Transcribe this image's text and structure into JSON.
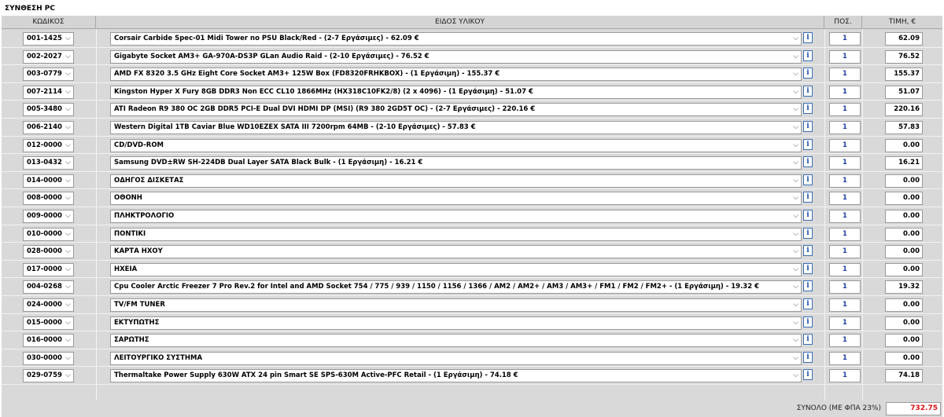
{
  "title": "ΣΥΝΘΕΣΗ PC",
  "headers": {
    "code": "ΚΩΔΙΚΟΣ",
    "item": "ΕΙΔΟΣ ΥΛΙΚΟΥ",
    "qty": "ΠΟΣ.",
    "price": "ΤΙΜΗ, €"
  },
  "info_glyph": "i",
  "chevron_glyph": "⌵",
  "rows": [
    {
      "code": "001-1425",
      "item": "Corsair Carbide Spec-01 Midi Tower no PSU Black/Red - (2-7 Εργάσιμες) - 62.09 €",
      "qty": "1",
      "price": "62.09"
    },
    {
      "code": "002-2027",
      "item": "Gigabyte Socket AM3+ GA-970A-DS3P GLan Audio Raid - (2-10 Εργάσιμες) - 76.52 €",
      "qty": "1",
      "price": "76.52"
    },
    {
      "code": "003-0779",
      "item": "AMD FX 8320 3.5 GHz Eight Core Socket AM3+ 125W Box (FD8320FRHKBOX) - (1 Εργάσιμη) - 155.37 €",
      "qty": "1",
      "price": "155.37"
    },
    {
      "code": "007-2114",
      "item": "Kingston Hyper X Fury 8GB DDR3 Non ECC CL10 1866MHz (HX318C10FK2/8) (2 x 4096) - (1 Εργάσιμη) - 51.07 €",
      "qty": "1",
      "price": "51.07"
    },
    {
      "code": "005-3480",
      "item": "ATI Radeon R9 380 OC 2GB DDR5 PCI-E Dual DVI HDMI DP (MSI) (R9 380 2GD5T OC) - (2-7 Εργάσιμες) - 220.16 €",
      "qty": "1",
      "price": "220.16"
    },
    {
      "code": "006-2140",
      "item": "Western Digital 1TB Caviar Blue WD10EZEX SATA III 7200rpm 64MB - (2-10 Εργάσιμες) - 57.83 €",
      "qty": "1",
      "price": "57.83"
    },
    {
      "code": "012-0000",
      "item": "CD/DVD-ROM",
      "qty": "1",
      "price": "0.00"
    },
    {
      "code": "013-0432",
      "item": "Samsung DVD±RW SH-224DB Dual Layer SATA Black Bulk - (1 Εργάσιμη) - 16.21 €",
      "qty": "1",
      "price": "16.21"
    },
    {
      "code": "014-0000",
      "item": "ΟΔΗΓΟΣ ΔΙΣΚΕΤΑΣ",
      "qty": "1",
      "price": "0.00"
    },
    {
      "code": "008-0000",
      "item": "ΟΘΟΝΗ",
      "qty": "1",
      "price": "0.00"
    },
    {
      "code": "009-0000",
      "item": "ΠΛΗΚΤΡΟΛΟΓΙΟ",
      "qty": "1",
      "price": "0.00"
    },
    {
      "code": "010-0000",
      "item": "ΠΟΝΤΙΚΙ",
      "qty": "1",
      "price": "0.00"
    },
    {
      "code": "028-0000",
      "item": "ΚΑΡΤΑ ΗΧΟΥ",
      "qty": "1",
      "price": "0.00"
    },
    {
      "code": "017-0000",
      "item": "ΗΧΕΙΑ",
      "qty": "1",
      "price": "0.00"
    },
    {
      "code": "004-0268",
      "item": "Cpu Cooler Arctic Freezer 7 Pro Rev.2 for Intel and AMD Socket 754 / 775 / 939 / 1150 / 1156 / 1366 / AM2 / AM2+ / AM3 / AM3+ / FM1 / FM2 / FM2+ - (1 Εργάσιμη) - 19.32 €",
      "qty": "1",
      "price": "19.32"
    },
    {
      "code": "024-0000",
      "item": "TV/FM TUNER",
      "qty": "1",
      "price": "0.00"
    },
    {
      "code": "015-0000",
      "item": "ΕΚΤΥΠΩΤΗΣ",
      "qty": "1",
      "price": "0.00"
    },
    {
      "code": "016-0000",
      "item": "ΣΑΡΩΤΗΣ",
      "qty": "1",
      "price": "0.00"
    },
    {
      "code": "030-0000",
      "item": "ΛΕΙΤΟΥΡΓΙΚΟ ΣΥΣΤΗΜΑ",
      "qty": "1",
      "price": "0.00"
    },
    {
      "code": "029-0759",
      "item": "Thermaltake Power Supply 630W ATX 24 pin Smart SE SPS-630M Active-PFC Retail - (1 Εργάσιμη) - 74.18 €",
      "qty": "1",
      "price": "74.18"
    }
  ],
  "total": {
    "label": "ΣΥΝΟΛΟ (ΜΕ ΦΠΑ 23%)",
    "value": "732.75",
    "value_color": "#e01010"
  }
}
